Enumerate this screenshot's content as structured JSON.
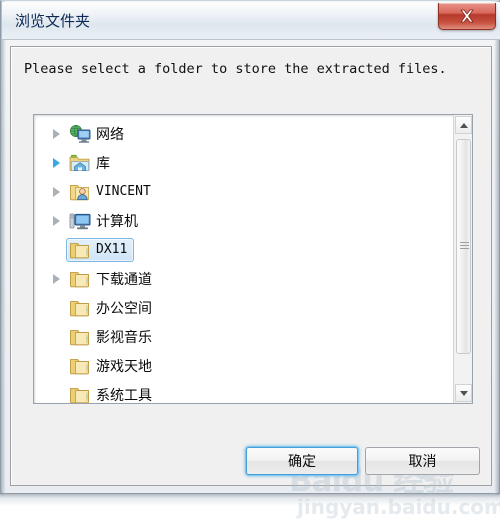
{
  "window": {
    "title": "浏览文件夹",
    "close_label": "✕",
    "close_icon": "close-icon"
  },
  "dialog": {
    "prompt": "Please select a folder to store the extracted files."
  },
  "tree": {
    "items": [
      {
        "label": "网络",
        "icon": "network-icon",
        "expandable": true,
        "expander_color": "gray",
        "selected": false,
        "indent": 0,
        "mono": false
      },
      {
        "label": "库",
        "icon": "library-icon",
        "expandable": true,
        "expander_color": "blue",
        "selected": false,
        "indent": 0,
        "mono": false
      },
      {
        "label": "VINCENT",
        "icon": "user-folder-icon",
        "expandable": true,
        "expander_color": "gray",
        "selected": false,
        "indent": 0,
        "mono": true
      },
      {
        "label": "计算机",
        "icon": "computer-icon",
        "expandable": true,
        "expander_color": "gray",
        "selected": false,
        "indent": 0,
        "mono": false
      },
      {
        "label": "DX11",
        "icon": "folder-icon",
        "expandable": false,
        "expander_color": "gray",
        "selected": true,
        "indent": 0,
        "mono": true
      },
      {
        "label": "下载通道",
        "icon": "folder-icon",
        "expandable": true,
        "expander_color": "gray",
        "selected": false,
        "indent": 0,
        "mono": false
      },
      {
        "label": "办公空间",
        "icon": "folder-icon",
        "expandable": false,
        "expander_color": "gray",
        "selected": false,
        "indent": 0,
        "mono": false
      },
      {
        "label": "影视音乐",
        "icon": "folder-icon",
        "expandable": false,
        "expander_color": "gray",
        "selected": false,
        "indent": 0,
        "mono": false
      },
      {
        "label": "游戏天地",
        "icon": "folder-icon",
        "expandable": false,
        "expander_color": "gray",
        "selected": false,
        "indent": 0,
        "mono": false
      },
      {
        "label": "系统工具",
        "icon": "folder-icon",
        "expandable": false,
        "expander_color": "gray",
        "selected": false,
        "indent": 0,
        "mono": false
      }
    ]
  },
  "scrollbar": {
    "up_icon": "scroll-up-arrow-icon",
    "down_icon": "scroll-down-arrow-icon",
    "thumb_icon": "scroll-thumb-grip-icon"
  },
  "buttons": {
    "ok_label": "确定",
    "cancel_label": "取消"
  },
  "watermark": {
    "main": "Baidu 经验",
    "sub": "jingyan.baidu.com"
  },
  "colors": {
    "accent": "#4a9ed8",
    "close_red": "#b63a2c",
    "selection_blue": "#cfe5f8",
    "folder_yellow": "#f2d98a",
    "title_text": "#0d2a58"
  }
}
